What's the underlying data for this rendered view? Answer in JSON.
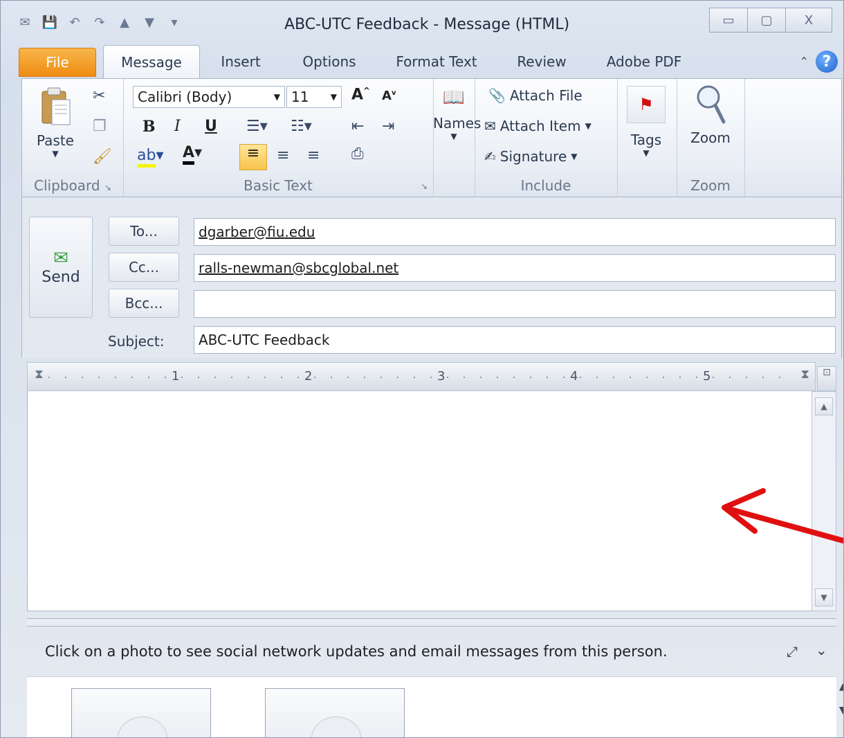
{
  "window": {
    "title": "ABC-UTC Feedback - Message (HTML)",
    "controls": [
      "▭",
      "▢",
      "X"
    ]
  },
  "quick_access": [
    "save-icon",
    "undo-icon",
    "redo-icon",
    "up-icon",
    "down-icon",
    "customize-icon"
  ],
  "tabs": [
    {
      "label": "File"
    },
    {
      "label": "Message"
    },
    {
      "label": "Insert"
    },
    {
      "label": "Options"
    },
    {
      "label": "Format Text"
    },
    {
      "label": "Review"
    },
    {
      "label": "Adobe PDF"
    }
  ],
  "ribbon": {
    "clipboard": {
      "paste": "Paste",
      "label": "Clipboard"
    },
    "basic_text": {
      "font": "Calibri (Body)",
      "size": "11",
      "label": "Basic Text",
      "bold": "B",
      "italic": "I",
      "underline": "U"
    },
    "names": {
      "label": "Names"
    },
    "include": {
      "attach_file": "Attach File",
      "attach_item": "Attach Item",
      "signature": "Signature",
      "label": "Include"
    },
    "tags": {
      "label": "Tags"
    },
    "zoom": {
      "button": "Zoom",
      "label": "Zoom"
    }
  },
  "compose": {
    "send": "Send",
    "to_button": "To...",
    "cc_button": "Cc...",
    "bcc_button": "Bcc...",
    "to_value": "dgarber@fiu.edu",
    "cc_value": "ralls-newman@sbcglobal.net",
    "bcc_value": "",
    "subject_label": "Subject:",
    "subject_value": "ABC-UTC Feedback"
  },
  "ruler": {
    "numbers": [
      "1",
      "2",
      "3",
      "4",
      "5"
    ]
  },
  "people_pane": {
    "text": "Click on a photo to see social network updates and email messages from this person."
  },
  "colors": {
    "file_tab": "#f08b12",
    "arrow": "#e01010"
  }
}
